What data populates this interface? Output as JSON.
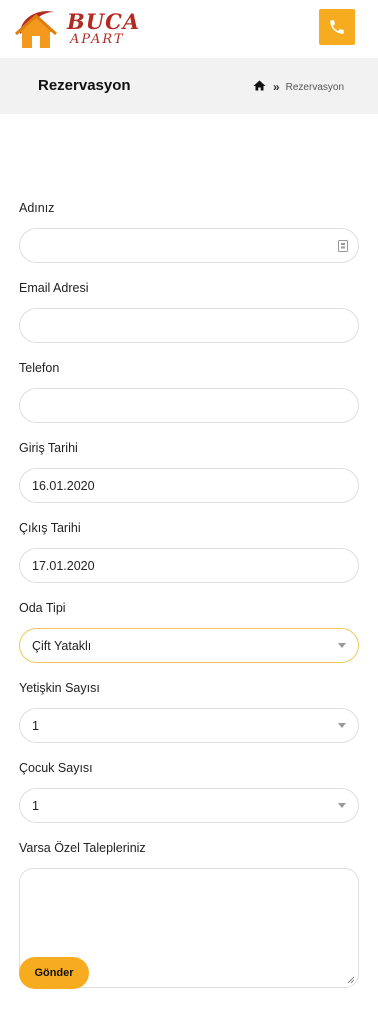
{
  "header": {
    "logo_line1": "BUCA",
    "logo_line2": "APART",
    "phone_icon": "phone-icon",
    "accent_color": "#f7ac1f",
    "brand_color": "#b22a22"
  },
  "breadcrumb": {
    "title": "Rezervasyon",
    "home_icon": "home-icon",
    "separator_icon": "double-chevron-right-icon",
    "current": "Rezervasyon"
  },
  "form": {
    "name": {
      "label": "Adınız",
      "value": ""
    },
    "email": {
      "label": "Email Adresi",
      "value": ""
    },
    "phone": {
      "label": "Telefon",
      "value": ""
    },
    "checkin": {
      "label": "Giriş Tarihi",
      "value": "16.01.2020"
    },
    "checkout": {
      "label": "Çıkış Tarihi",
      "value": "17.01.2020"
    },
    "room_type": {
      "label": "Oda Tipi",
      "value": "Çift Yataklı"
    },
    "adults": {
      "label": "Yetişkin Sayısı",
      "value": "1"
    },
    "children": {
      "label": "Çocuk Sayısı",
      "value": "1"
    },
    "requests": {
      "label": "Varsa Özel Talepleriniz",
      "value": ""
    },
    "submit_label": "Gönder"
  }
}
